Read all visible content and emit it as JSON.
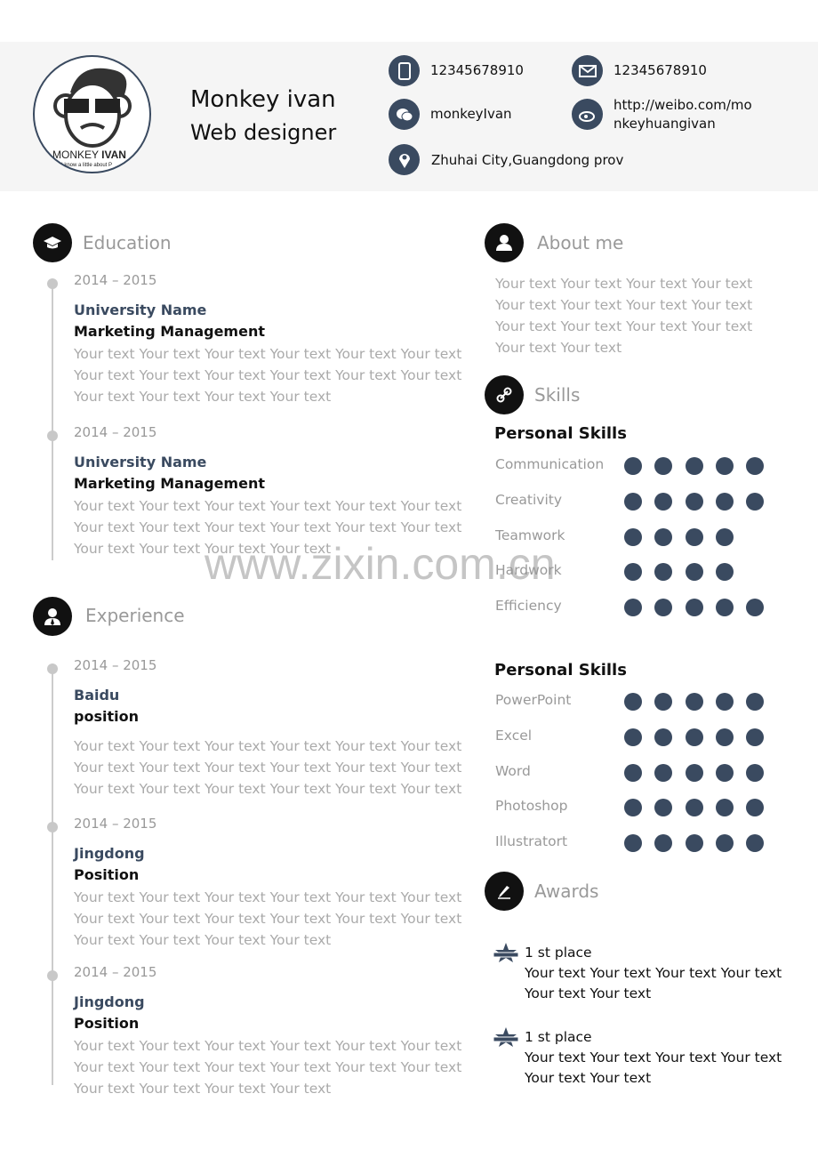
{
  "header": {
    "name": "Monkey ivan",
    "role": "Web designer",
    "logo_text": "MONKEY IVAN",
    "logo_tagline": "I know a little about P",
    "contacts": [
      {
        "icon": "phone-icon",
        "text": "12345678910"
      },
      {
        "icon": "mail-icon",
        "text": "12345678910"
      },
      {
        "icon": "wechat-icon",
        "text": "monkeyIvan"
      },
      {
        "icon": "weibo-icon",
        "text": "http://weibo.com/monkeyhuangivan"
      },
      {
        "icon": "location-icon",
        "text": "Zhuhai City,Guangdong prov"
      }
    ]
  },
  "education": {
    "title": "Education",
    "items": [
      {
        "date": "2014 – 2015",
        "org": "University Name",
        "position": "Marketing Management",
        "text": "Your text Your text Your text Your text Your text Your text Your text Your text Your text Your text Your text Your text Your text Your text Your text Your text"
      },
      {
        "date": "2014 – 2015",
        "org": "University Name",
        "position": "Marketing Management",
        "text": "Your text Your text Your text Your text Your text Your text Your text Your text Your text Your text Your text Your text Your text Your text Your text Your text"
      }
    ]
  },
  "experience": {
    "title": "Experience",
    "items": [
      {
        "date": "2014 – 2015",
        "org": "Baidu",
        "position": "position",
        "text": "Your text Your text Your text Your text Your text Your text Your text Your text Your text Your text Your text Your text Your text Your text Your text Your text Your text Your text"
      },
      {
        "date": "2014 – 2015",
        "org": "Jingdong",
        "position": "Position",
        "text": "Your text Your text Your text Your text Your text Your text Your text Your text Your text Your text Your text Your text Your text Your text Your text Your text"
      },
      {
        "date": "2014 – 2015",
        "org": "Jingdong",
        "position": "Position",
        "text": "Your text Your text Your text Your text Your text Your text Your text Your text Your text Your text Your text Your text Your text Your text Your text Your text"
      }
    ]
  },
  "about": {
    "title": "About me",
    "text": "Your text Your text Your text Your text Your text Your text Your text Your text Your text Your text Your text Your text Your text Your text"
  },
  "skills": {
    "title": "Skills",
    "groups": [
      {
        "heading": "Personal Skills",
        "items": [
          {
            "name": "Communication",
            "level": 5
          },
          {
            "name": "Creativity",
            "level": 5
          },
          {
            "name": "Teamwork",
            "level": 4
          },
          {
            "name": "Hardwork",
            "level": 4
          },
          {
            "name": "Efficiency",
            "level": 5
          }
        ]
      },
      {
        "heading": "Personal Skills",
        "items": [
          {
            "name": "PowerPoint",
            "level": 5
          },
          {
            "name": "Excel",
            "level": 5
          },
          {
            "name": "Word",
            "level": 5
          },
          {
            "name": "Photoshop",
            "level": 5
          },
          {
            "name": "Illustratort",
            "level": 5
          }
        ]
      }
    ]
  },
  "awards": {
    "title": "Awards",
    "items": [
      {
        "title": "1 st place",
        "text": "Your text Your text Your text Your text Your text Your text"
      },
      {
        "title": "1 st place",
        "text": "Your text Your text Your text Your text Your text Your text"
      }
    ]
  },
  "watermark": "www.zixin.com.cn",
  "colors": {
    "accent": "#3a4a60",
    "header_bg": "#f5f5f5"
  }
}
